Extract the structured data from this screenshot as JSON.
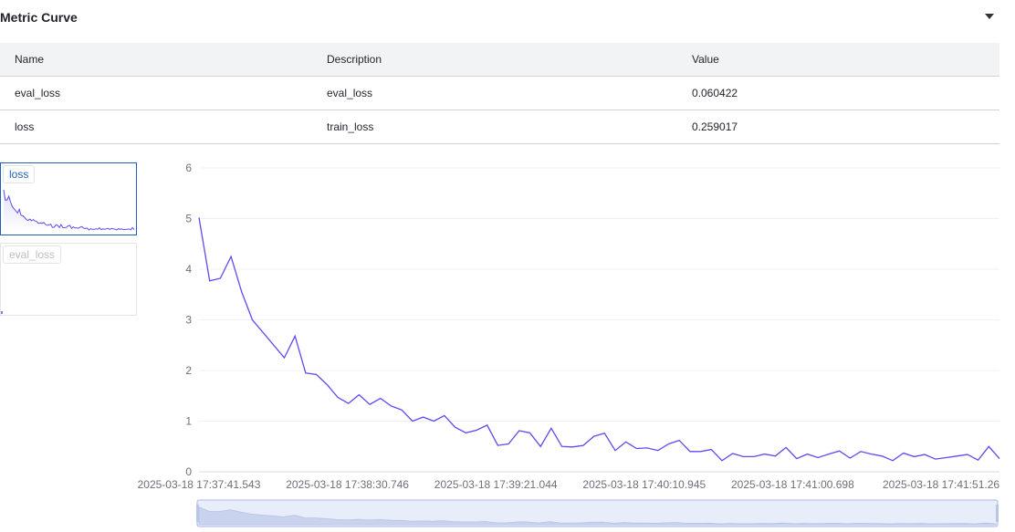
{
  "panel": {
    "title": "Metric Curve",
    "collapse_icon": "caret-down-icon"
  },
  "table": {
    "headers": [
      "Name",
      "Description",
      "Value"
    ],
    "rows": [
      [
        "eval_loss",
        "eval_loss",
        "0.060422"
      ],
      [
        "loss",
        "train_loss",
        "0.259017"
      ]
    ]
  },
  "metric_tabs": [
    {
      "label": "loss",
      "selected": true
    },
    {
      "label": "eval_loss",
      "selected": false
    }
  ],
  "colors": {
    "line": "#5b4cf0",
    "grid": "#eef0f3",
    "axis_text": "#6e7079",
    "selected_border": "#1f5fb8"
  },
  "chart_data": {
    "type": "line",
    "series": [
      {
        "name": "loss",
        "values": [
          5.02,
          3.77,
          3.82,
          4.25,
          3.55,
          3.0,
          2.75,
          2.5,
          2.25,
          2.68,
          1.95,
          1.92,
          1.72,
          1.47,
          1.35,
          1.52,
          1.33,
          1.45,
          1.3,
          1.22,
          1.0,
          1.08,
          1.0,
          1.11,
          0.88,
          0.77,
          0.82,
          0.92,
          0.52,
          0.55,
          0.81,
          0.77,
          0.5,
          0.86,
          0.5,
          0.49,
          0.52,
          0.7,
          0.76,
          0.42,
          0.59,
          0.46,
          0.47,
          0.42,
          0.55,
          0.62,
          0.4,
          0.4,
          0.44,
          0.22,
          0.36,
          0.3,
          0.3,
          0.35,
          0.31,
          0.48,
          0.26,
          0.35,
          0.28,
          0.35,
          0.41,
          0.27,
          0.4,
          0.35,
          0.31,
          0.22,
          0.37,
          0.3,
          0.34,
          0.25,
          0.28,
          0.31,
          0.34,
          0.23,
          0.5,
          0.26
        ]
      }
    ],
    "x_tick_labels": [
      "2025-03-18 17:37:41.543",
      "2025-03-18 17:38:30.746",
      "2025-03-18 17:39:21.044",
      "2025-03-18 17:40:10.945",
      "2025-03-18 17:41:00.698",
      "2025-03-18 17:41:51.26"
    ],
    "y_ticks": [
      0,
      1,
      2,
      3,
      4,
      5,
      6
    ],
    "ylim": [
      0,
      6
    ],
    "grid": true
  }
}
